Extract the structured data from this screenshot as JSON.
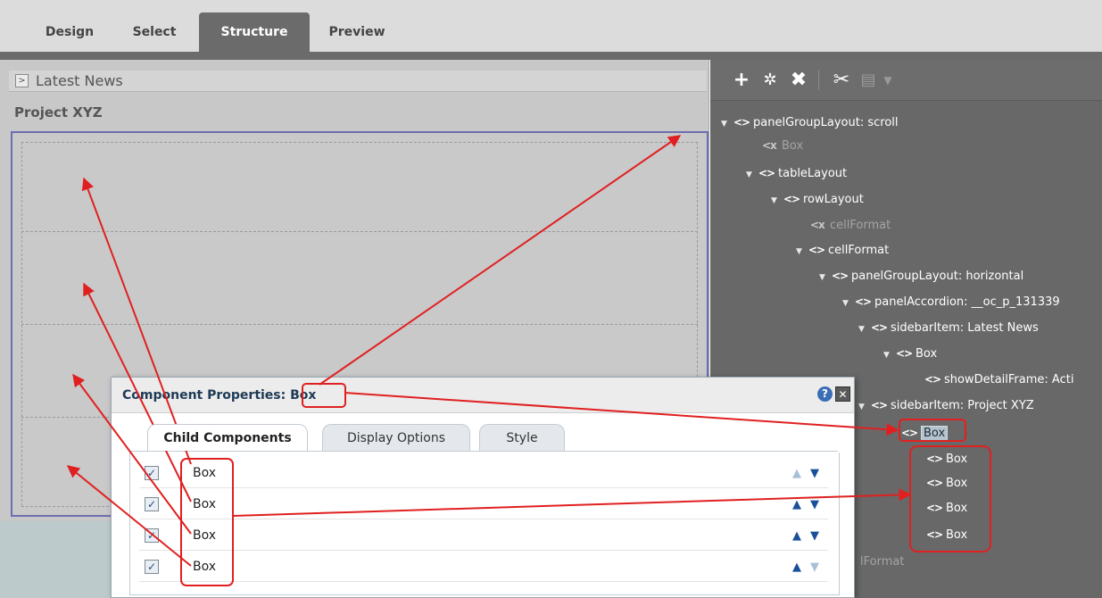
{
  "tabs": [
    {
      "label": "Design",
      "active": false
    },
    {
      "label": "Select",
      "active": false
    },
    {
      "label": "Structure",
      "active": true
    },
    {
      "label": "Preview",
      "active": false
    }
  ],
  "canvas": {
    "accordion_label": "Latest News",
    "section_title": "Project XYZ"
  },
  "toolbar": {
    "icons": [
      "add-icon",
      "edit-icon",
      "delete-icon",
      "cut-icon",
      "paste-icon",
      "dropdown-icon"
    ]
  },
  "tree": [
    {
      "label": "panelGroupLayout: scroll",
      "state": "expanded"
    },
    {
      "label": "Box",
      "state": "muted"
    },
    {
      "label": "tableLayout",
      "state": "expanded"
    },
    {
      "label": "rowLayout",
      "state": "expanded"
    },
    {
      "label": "cellFormat",
      "state": "muted"
    },
    {
      "label": "cellFormat",
      "state": "expanded"
    },
    {
      "label": "panelGroupLayout: horizontal",
      "state": "expanded"
    },
    {
      "label": "panelAccordion: __oc_p_131339",
      "state": "expanded"
    },
    {
      "label": "sidebarItem: Latest News",
      "state": "expanded"
    },
    {
      "label": "Box",
      "state": "expanded"
    },
    {
      "label": "showDetailFrame: Acti",
      "state": "leaf"
    },
    {
      "label": "sidebarItem: Project XYZ",
      "state": "expanded"
    },
    {
      "label": "Box",
      "state": "selected"
    },
    {
      "label": "Box",
      "state": "leaf"
    },
    {
      "label": "Box",
      "state": "leaf"
    },
    {
      "label": "Box",
      "state": "leaf"
    },
    {
      "label": "Box",
      "state": "leaf"
    },
    {
      "label": "lFormat",
      "state": "muted"
    }
  ],
  "dialog": {
    "title_prefix": "Component Properties:",
    "title_value": "Box",
    "help": "?",
    "close": "✕",
    "tabs": [
      {
        "label": "Child Components",
        "active": true
      },
      {
        "label": "Display Options",
        "active": false
      },
      {
        "label": "Style",
        "active": false
      }
    ],
    "rows": [
      {
        "name": "Box",
        "checked": true,
        "up_enabled": false,
        "down_enabled": true
      },
      {
        "name": "Box",
        "checked": true,
        "up_enabled": true,
        "down_enabled": true
      },
      {
        "name": "Box",
        "checked": true,
        "up_enabled": true,
        "down_enabled": true
      },
      {
        "name": "Box",
        "checked": true,
        "up_enabled": true,
        "down_enabled": false
      }
    ]
  },
  "colors": {
    "annotation": "#e02020",
    "selection": "#6d6db0",
    "tree_bg": "#686868"
  }
}
